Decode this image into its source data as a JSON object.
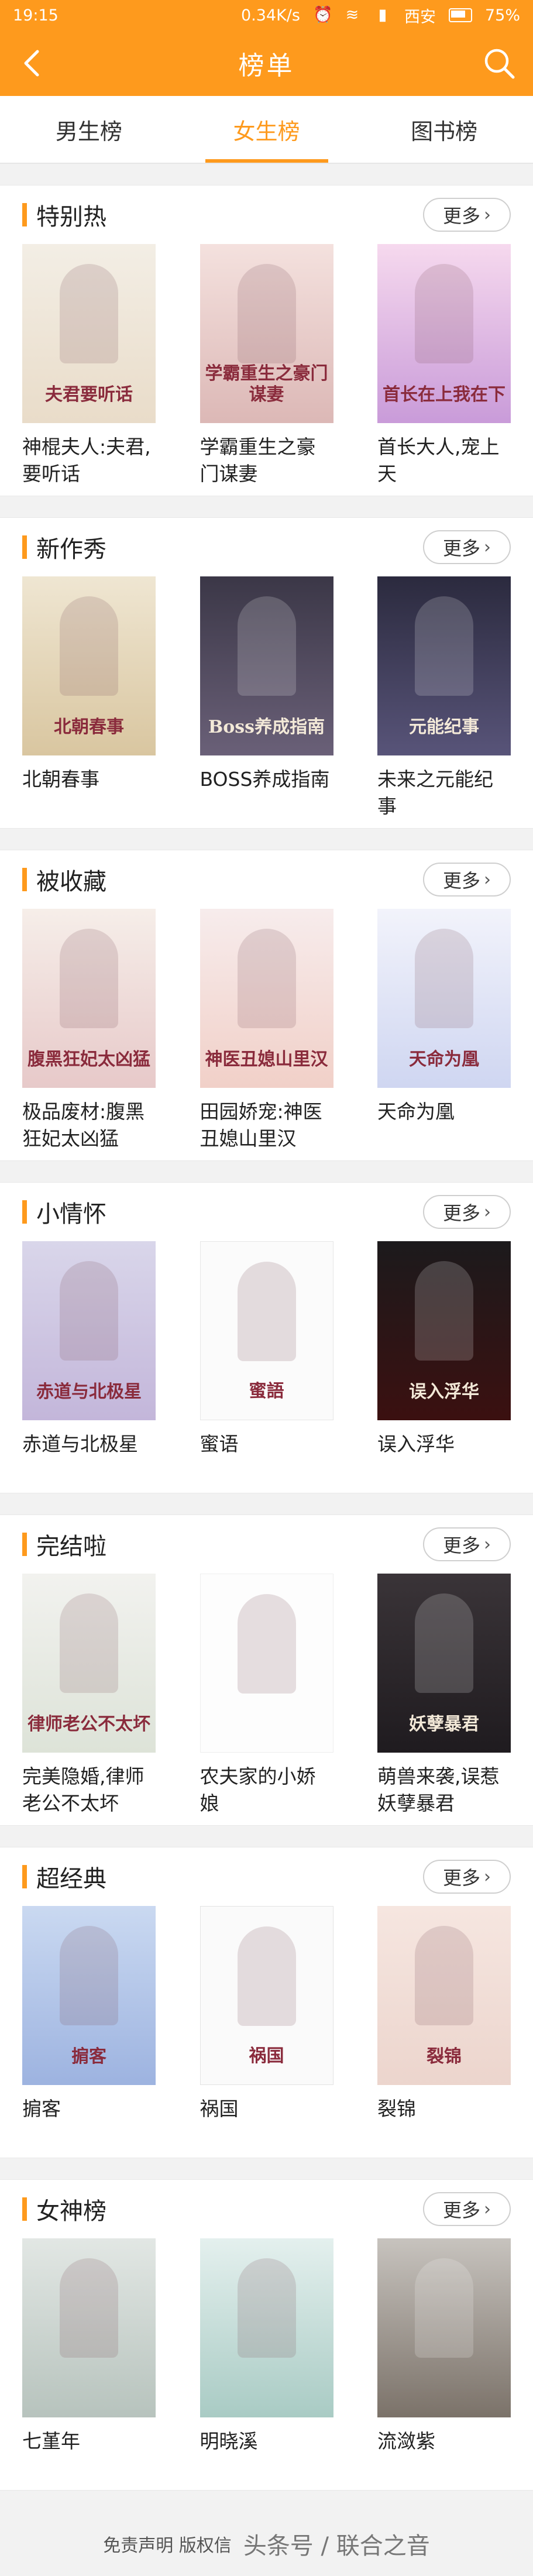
{
  "status_bar": {
    "time": "19:15",
    "speed": "0.34K/s",
    "carrier": "西安",
    "battery": "75%"
  },
  "header": {
    "title": "榜单"
  },
  "tabs": [
    {
      "label": "男生榜",
      "active": false
    },
    {
      "label": "女生榜",
      "active": true
    },
    {
      "label": "图书榜",
      "active": false
    }
  ],
  "more_label": "更多",
  "sections": [
    {
      "title": "特别热",
      "books": [
        {
          "title": "神棍夫人:夫君,要听话",
          "cover_text": "夫君要听话"
        },
        {
          "title": "学霸重生之豪门谋妻",
          "cover_text": "学霸重生之豪门谋妻"
        },
        {
          "title": "首长大人,宠上天",
          "cover_text": "首长在上我在下"
        }
      ]
    },
    {
      "title": "新作秀",
      "books": [
        {
          "title": "北朝春事",
          "cover_text": "北朝春事"
        },
        {
          "title": "BOSS养成指南",
          "cover_text": "Boss养成指南"
        },
        {
          "title": "未来之元能纪事",
          "cover_text": "元能纪事"
        }
      ]
    },
    {
      "title": "被收藏",
      "books": [
        {
          "title": "极品废材:腹黑狂妃太凶猛",
          "cover_text": "腹黑狂妃太凶猛"
        },
        {
          "title": "田园娇宠:神医丑媳山里汉",
          "cover_text": "神医丑媳山里汉"
        },
        {
          "title": "天命为凰",
          "cover_text": "天命为凰"
        }
      ]
    },
    {
      "title": "小情怀",
      "books": [
        {
          "title": "赤道与北极星",
          "cover_text": "赤道与北极星"
        },
        {
          "title": "蜜语",
          "cover_text": "蜜語"
        },
        {
          "title": "误入浮华",
          "cover_text": "误入浮华"
        }
      ]
    },
    {
      "title": "完结啦",
      "books": [
        {
          "title": "完美隐婚,律师老公不太坏",
          "cover_text": "律师老公不太坏"
        },
        {
          "title": "农夫家的小娇娘",
          "cover_text": ""
        },
        {
          "title": "萌兽来袭,误惹妖孽暴君",
          "cover_text": "妖孽暴君"
        }
      ]
    },
    {
      "title": "超经典",
      "books": [
        {
          "title": "掮客",
          "cover_text": "掮客"
        },
        {
          "title": "祸国",
          "cover_text": "祸国"
        },
        {
          "title": "裂锦",
          "cover_text": "裂锦"
        }
      ]
    },
    {
      "title": "女神榜",
      "books": [
        {
          "title": "七堇年",
          "cover_text": ""
        },
        {
          "title": "明晓溪",
          "cover_text": ""
        },
        {
          "title": "流潋紫",
          "cover_text": ""
        }
      ]
    }
  ],
  "footer": {
    "text": "免责声明 版权信",
    "watermark": "头条号 / 联合之音"
  }
}
